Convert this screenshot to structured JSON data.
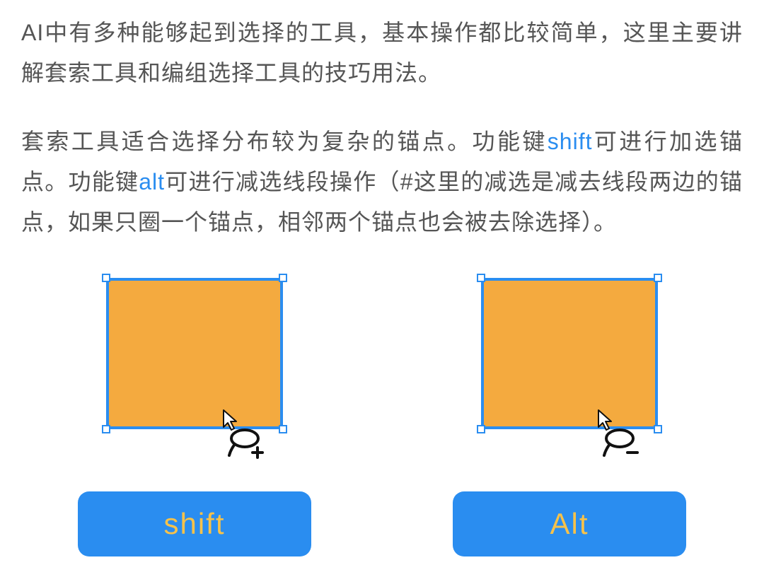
{
  "para1": {
    "t1": "AI中有多种能够起到选择的工具，基本操作都比较简单，这里主要讲解套索工具和编组选择工具的技巧用法。"
  },
  "para2": {
    "t1": "套索工具适合选择分布较为复杂的锚点。功能键",
    "link1": "shift",
    "t2": "可进行加选锚点。功能键",
    "link2": "alt",
    "t3": "可进行减选线段操作（#这里的减选是减去线段两边的锚点，如果只圈一个锚点，相邻两个锚点也会被去除选择）。"
  },
  "keys": {
    "shift": "shift",
    "alt": "Alt"
  },
  "colors": {
    "accent": "#2a8df0",
    "fill": "#f4aa3f",
    "key_text": "#f7c24a"
  }
}
